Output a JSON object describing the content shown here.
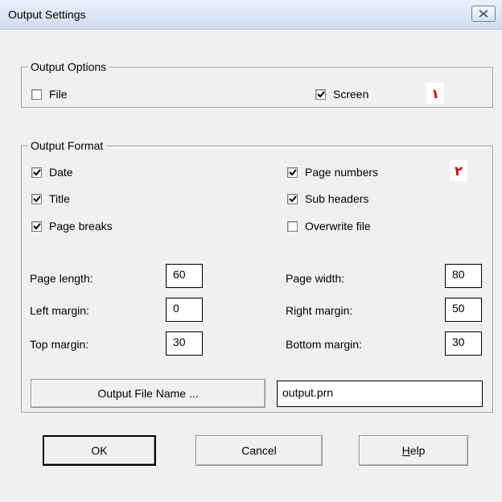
{
  "window": {
    "title": "Output Settings"
  },
  "output_options": {
    "legend": "Output Options",
    "file": {
      "label": "File",
      "checked": false
    },
    "screen": {
      "label": "Screen",
      "checked": true
    },
    "marker": "١"
  },
  "output_format": {
    "legend": "Output Format",
    "marker": "٢",
    "date": {
      "label": "Date",
      "checked": true
    },
    "title": {
      "label": "Title",
      "checked": true
    },
    "page_breaks": {
      "label": "Page breaks",
      "checked": true
    },
    "page_numbers": {
      "label": "Page numbers",
      "checked": true
    },
    "sub_headers": {
      "label": "Sub headers",
      "checked": true
    },
    "overwrite_file": {
      "label": "Overwrite file",
      "checked": false
    },
    "page_length": {
      "label": "Page length:",
      "value": "60"
    },
    "left_margin": {
      "label": "Left margin:",
      "value": "0"
    },
    "top_margin": {
      "label": "Top margin:",
      "value": "30"
    },
    "page_width": {
      "label": "Page width:",
      "value": "80"
    },
    "right_margin": {
      "label": "Right margin:",
      "value": "50"
    },
    "bottom_margin": {
      "label": "Bottom margin:",
      "value": "30"
    },
    "output_file_button": "Output File Name ...",
    "output_file_value": "output.prn"
  },
  "buttons": {
    "ok": "OK",
    "cancel": "Cancel",
    "help": "Help",
    "help_mnemonic": "H",
    "help_rest": "elp"
  }
}
